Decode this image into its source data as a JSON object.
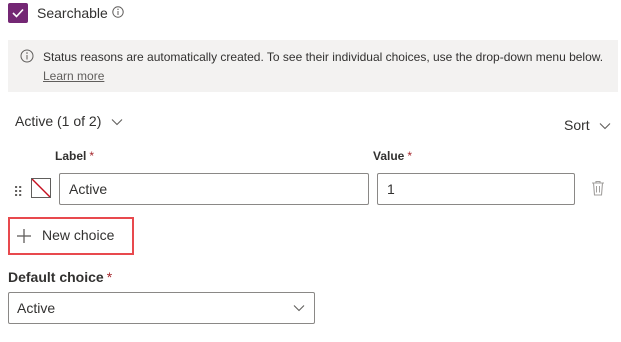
{
  "searchable": {
    "label": "Searchable",
    "checked": true
  },
  "info_banner": {
    "text": "Status reasons are automatically created. To see their individual choices, use the drop-down menu below.",
    "link": "Learn more"
  },
  "section": {
    "title": "Active (1 of 2)",
    "sort_label": "Sort"
  },
  "columns": {
    "label_header": "Label",
    "value_header": "Value",
    "required_mark": "*"
  },
  "choices": [
    {
      "label": "Active",
      "value": "1"
    }
  ],
  "new_choice_label": "New choice",
  "default_choice": {
    "label": "Default choice",
    "selected": "Active"
  },
  "colors": {
    "accent": "#742774",
    "highlight": "#e8494d",
    "banner_bg": "#f3f2f1"
  }
}
